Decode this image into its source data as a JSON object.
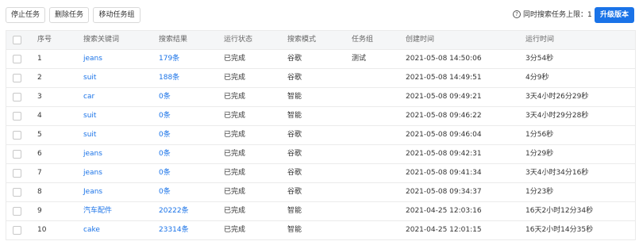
{
  "toolbar": {
    "stop_label": "停止任务",
    "delete_label": "删除任务",
    "move_label": "移动任务组",
    "limit_text": "同时搜索任务上限：1",
    "upgrade_label": "升级版本"
  },
  "table": {
    "columns": [
      "序号",
      "搜索关键词",
      "搜索结果",
      "运行状态",
      "搜索模式",
      "任务组",
      "创建时间",
      "运行时间"
    ],
    "rows": [
      {
        "num": "1",
        "keyword": "jeans",
        "result": "179条",
        "status": "已完成",
        "mode": "谷歌",
        "group": "测试",
        "created": "2021-05-08 14:50:06",
        "runtime": "3分54秒"
      },
      {
        "num": "2",
        "keyword": "suit",
        "result": "188条",
        "status": "已完成",
        "mode": "谷歌",
        "group": "",
        "created": "2021-05-08 14:49:51",
        "runtime": "4分9秒"
      },
      {
        "num": "3",
        "keyword": "car",
        "result": "0条",
        "status": "已完成",
        "mode": "智能",
        "group": "",
        "created": "2021-05-08 09:49:21",
        "runtime": "3天4小时26分29秒"
      },
      {
        "num": "4",
        "keyword": "suit",
        "result": "0条",
        "status": "已完成",
        "mode": "智能",
        "group": "",
        "created": "2021-05-08 09:46:22",
        "runtime": "3天4小时29分28秒"
      },
      {
        "num": "5",
        "keyword": "suit",
        "result": "0条",
        "status": "已完成",
        "mode": "谷歌",
        "group": "",
        "created": "2021-05-08 09:46:04",
        "runtime": "1分56秒"
      },
      {
        "num": "6",
        "keyword": "jeans",
        "result": "0条",
        "status": "已完成",
        "mode": "谷歌",
        "group": "",
        "created": "2021-05-08 09:42:31",
        "runtime": "1分29秒"
      },
      {
        "num": "7",
        "keyword": "jeans",
        "result": "0条",
        "status": "已完成",
        "mode": "谷歌",
        "group": "",
        "created": "2021-05-08 09:41:34",
        "runtime": "3天4小时34分16秒"
      },
      {
        "num": "8",
        "keyword": "Jeans",
        "result": "0条",
        "status": "已完成",
        "mode": "谷歌",
        "group": "",
        "created": "2021-05-08 09:34:37",
        "runtime": "1分23秒"
      },
      {
        "num": "9",
        "keyword": "汽车配件",
        "result": "20222条",
        "status": "已完成",
        "mode": "智能",
        "group": "",
        "created": "2021-04-25 12:03:16",
        "runtime": "16天2小时12分34秒"
      },
      {
        "num": "10",
        "keyword": "cake",
        "result": "23314条",
        "status": "已完成",
        "mode": "智能",
        "group": "",
        "created": "2021-04-25 12:01:15",
        "runtime": "16天2小时14分35秒"
      }
    ]
  }
}
